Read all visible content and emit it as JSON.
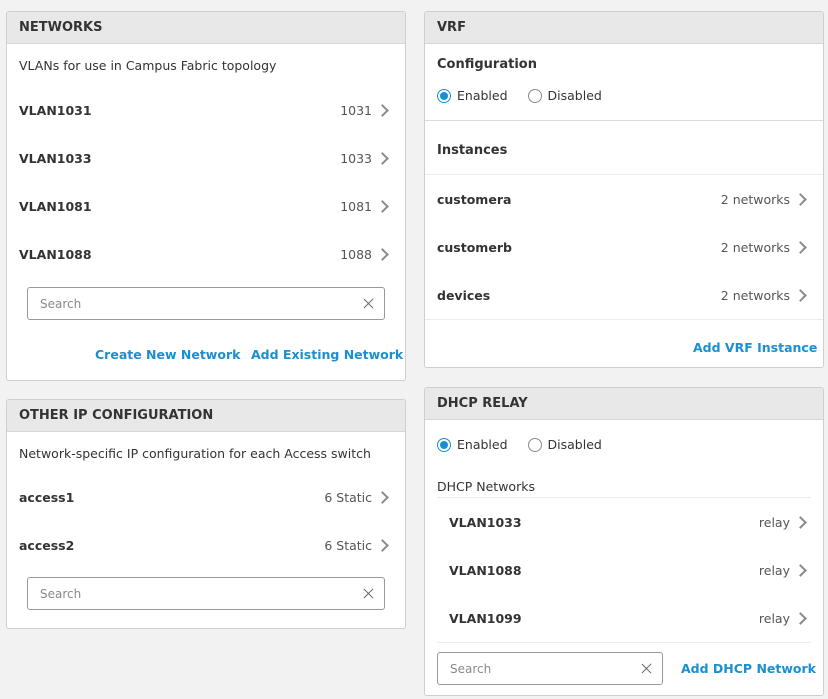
{
  "networks": {
    "title": "NETWORKS",
    "description": "VLANs for use in Campus Fabric topology",
    "items": [
      {
        "name": "VLAN1031",
        "value": "1031"
      },
      {
        "name": "VLAN1033",
        "value": "1033"
      },
      {
        "name": "VLAN1081",
        "value": "1081"
      },
      {
        "name": "VLAN1088",
        "value": "1088"
      }
    ],
    "search_placeholder": "Search",
    "create_link": "Create New Network",
    "add_link": "Add Existing Network"
  },
  "other_ip": {
    "title": "OTHER IP CONFIGURATION",
    "description": "Network-specific IP configuration for each Access switch",
    "items": [
      {
        "name": "access1",
        "value": "6 Static"
      },
      {
        "name": "access2",
        "value": "6 Static"
      }
    ],
    "search_placeholder": "Search"
  },
  "vrf": {
    "title": "VRF",
    "config_label": "Configuration",
    "enabled_label": "Enabled",
    "disabled_label": "Disabled",
    "instances_label": "Instances",
    "instances": [
      {
        "name": "customera",
        "value": "2 networks"
      },
      {
        "name": "customerb",
        "value": "2 networks"
      },
      {
        "name": "devices",
        "value": "2 networks"
      }
    ],
    "add_link": "Add VRF Instance"
  },
  "dhcp": {
    "title": "DHCP RELAY",
    "enabled_label": "Enabled",
    "disabled_label": "Disabled",
    "networks_label": "DHCP Networks",
    "networks": [
      {
        "name": "VLAN1033",
        "value": "relay"
      },
      {
        "name": "VLAN1088",
        "value": "relay"
      },
      {
        "name": "VLAN1099",
        "value": "relay"
      }
    ],
    "search_placeholder": "Search",
    "add_link": "Add DHCP Network"
  },
  "colors": {
    "accent": "#1a8fd1",
    "header_bg": "#e8e8e8",
    "page_bg": "#f2f2f2"
  }
}
